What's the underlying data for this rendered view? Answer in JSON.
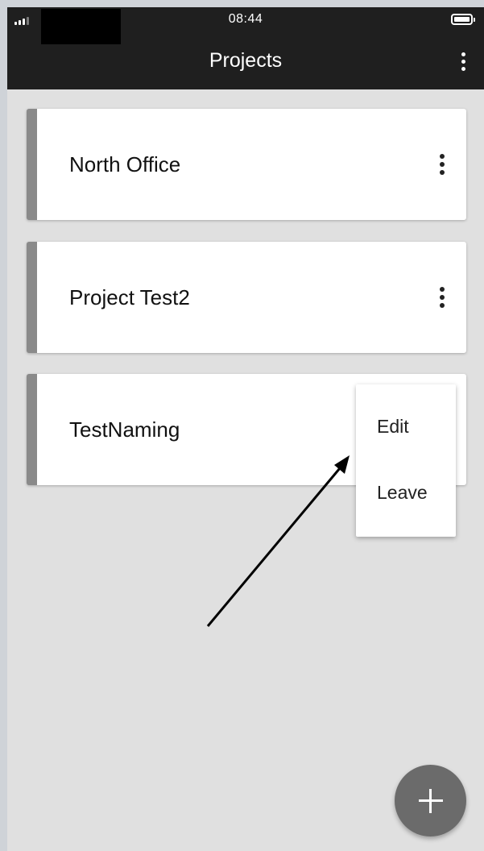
{
  "status_bar": {
    "time": "08:44"
  },
  "app_bar": {
    "title": "Projects"
  },
  "projects": [
    {
      "name": "North Office"
    },
    {
      "name": "Project Test2"
    },
    {
      "name": "TestNaming"
    }
  ],
  "context_menu": {
    "items": [
      "Edit",
      "Leave"
    ]
  },
  "colors": {
    "appbar": "#1f1f1f",
    "background": "#e0e0e0",
    "card_accent": "#8a8a8a",
    "fab": "#6b6b6b"
  },
  "icons": {
    "fab": "plus-icon",
    "overflow": "more-vert-icon"
  }
}
